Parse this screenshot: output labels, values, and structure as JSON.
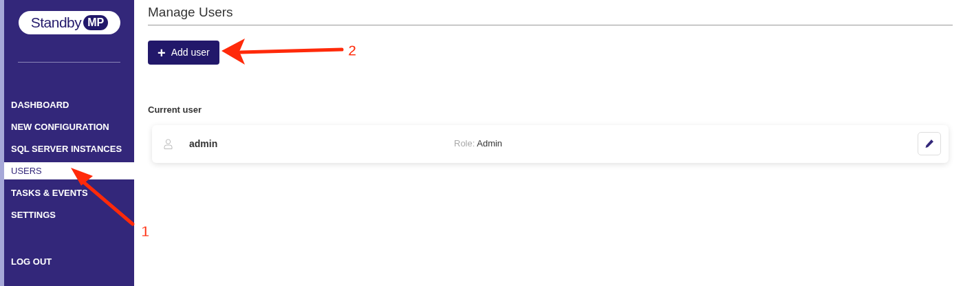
{
  "sidebar": {
    "logo": {
      "word": "Standby",
      "badge": "MP"
    },
    "items": [
      {
        "label": "DASHBOARD",
        "selected": false
      },
      {
        "label": "NEW CONFIGURATION",
        "selected": false
      },
      {
        "label": "SQL SERVER INSTANCES",
        "selected": false
      },
      {
        "label": "USERS",
        "selected": true
      },
      {
        "label": "TASKS & EVENTS",
        "selected": false
      },
      {
        "label": "SETTINGS",
        "selected": false
      }
    ],
    "logout": "LOG OUT"
  },
  "page": {
    "title": "Manage Users",
    "add_button": {
      "icon": "+",
      "label": "Add user"
    },
    "section_title": "Current user",
    "users": [
      {
        "name": "admin",
        "role_label": "Role:",
        "role": "Admin"
      }
    ]
  },
  "annotations": [
    {
      "number": "1"
    },
    {
      "number": "2"
    }
  ]
}
